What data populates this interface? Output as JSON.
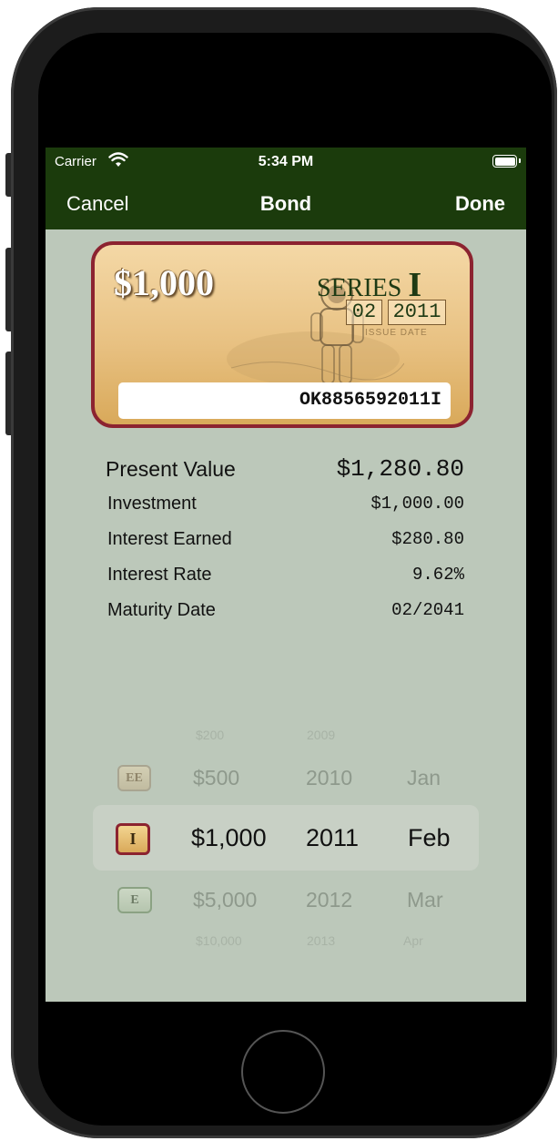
{
  "status": {
    "carrier": "Carrier",
    "time": "5:34 PM"
  },
  "nav": {
    "cancel": "Cancel",
    "title": "Bond",
    "done": "Done"
  },
  "bond": {
    "denomination": "$1,000",
    "series_word": "SERIES",
    "series_letter": "I",
    "issue_month": "02",
    "issue_year": "2011",
    "issue_label": "ISSUE DATE",
    "serial": "OK8856592011I"
  },
  "summary": {
    "present_value_label": "Present Value",
    "present_value": "$1,280.80",
    "rows": [
      {
        "label": "Investment",
        "value": "$1,000.00"
      },
      {
        "label": "Interest Earned",
        "value": "$280.80"
      },
      {
        "label": "Interest Rate",
        "value": "9.62%"
      },
      {
        "label": "Maturity Date",
        "value": "02/2041"
      }
    ]
  },
  "picker": {
    "series": [
      "EE",
      "I",
      "E"
    ],
    "denominations": [
      "$200",
      "$500",
      "$1,000",
      "$5,000",
      "$10,000"
    ],
    "years": [
      "2009",
      "2010",
      "2011",
      "2012",
      "2013"
    ],
    "months": [
      "Jan",
      "Feb",
      "Mar",
      "Apr"
    ],
    "selected": {
      "series": "I",
      "denomination": "$1,000",
      "year": "2011",
      "month": "Feb"
    }
  },
  "colors": {
    "nav_bg": "#1b3b0c",
    "screen_bg": "#bcc8ba",
    "bond_border": "#8c2330"
  }
}
